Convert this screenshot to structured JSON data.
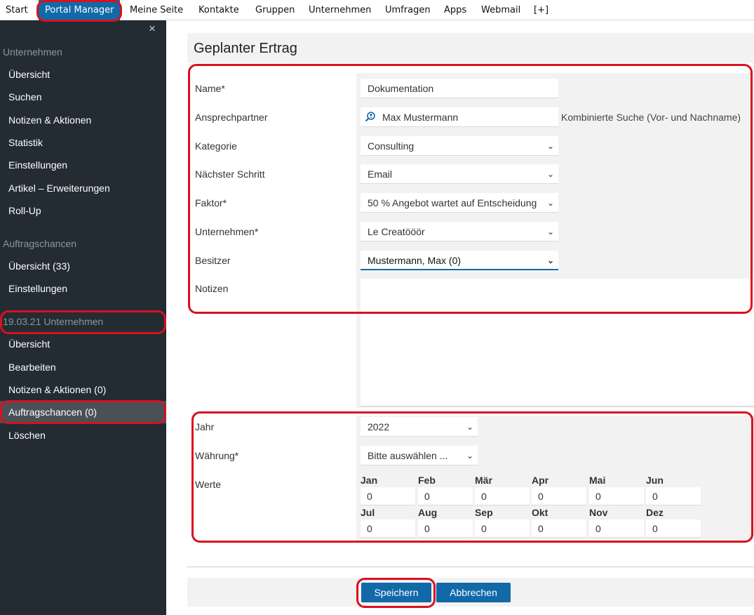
{
  "topnav": {
    "items": [
      "Start",
      "Portal Manager",
      "Meine Seite",
      "Kontakte",
      "Gruppen",
      "Unternehmen",
      "Umfragen",
      "Apps",
      "Webmail",
      "[+]"
    ],
    "active": "Portal Manager"
  },
  "sidebar": {
    "close": "×",
    "section1": {
      "title": "Unternehmen",
      "items": [
        "Übersicht",
        "Suchen",
        "Notizen & Aktionen",
        "Statistik",
        "Einstellungen",
        "Artikel – Erweiterungen",
        "Roll-Up"
      ]
    },
    "section2": {
      "title": "Auftragschancen",
      "items": [
        "Übersicht (33)",
        "Einstellungen"
      ]
    },
    "section3": {
      "title": "19.03.21 Unternehmen",
      "items": [
        "Übersicht",
        "Bearbeiten",
        "Notizen & Aktionen (0)",
        "Auftragschancen (0)",
        "Löschen"
      ],
      "selected": "Auftragschancen (0)"
    }
  },
  "form": {
    "title": "Geplanter Ertrag",
    "name": {
      "label": "Name*",
      "value": "Dokumentation"
    },
    "contact": {
      "label": "Ansprechpartner",
      "value": "Max Mustermann",
      "hint": "Kombinierte Suche (Vor- und Nachname)"
    },
    "category": {
      "label": "Kategorie",
      "value": "Consulting"
    },
    "next_step": {
      "label": "Nächster Schritt",
      "value": "Email"
    },
    "factor": {
      "label": "Faktor*",
      "value": "50 % Angebot wartet auf Entscheidung"
    },
    "company": {
      "label": "Unternehmen*",
      "value": "Le Creatööör"
    },
    "owner": {
      "label": "Besitzer",
      "value": "Mustermann, Max (0)"
    },
    "notes": {
      "label": "Notizen",
      "value": ""
    },
    "year": {
      "label": "Jahr",
      "value": "2022"
    },
    "currency": {
      "label": "Währung*",
      "value": "Bitte auswählen ..."
    },
    "values_label": "Werte",
    "months": [
      {
        "name": "Jan",
        "value": "0"
      },
      {
        "name": "Feb",
        "value": "0"
      },
      {
        "name": "Mär",
        "value": "0"
      },
      {
        "name": "Apr",
        "value": "0"
      },
      {
        "name": "Mai",
        "value": "0"
      },
      {
        "name": "Jun",
        "value": "0"
      },
      {
        "name": "Jul",
        "value": "0"
      },
      {
        "name": "Aug",
        "value": "0"
      },
      {
        "name": "Sep",
        "value": "0"
      },
      {
        "name": "Okt",
        "value": "0"
      },
      {
        "name": "Nov",
        "value": "0"
      },
      {
        "name": "Dez",
        "value": "0"
      }
    ],
    "save_label": "Speichern",
    "cancel_label": "Abbrechen"
  },
  "colors": {
    "accent": "#1169a8",
    "sidebar_bg": "#232b33",
    "annotation": "#d8111e"
  },
  "icons": {
    "contact_search": "search-person-icon",
    "dropdown": "chevron-down-icon",
    "close": "close-icon"
  }
}
